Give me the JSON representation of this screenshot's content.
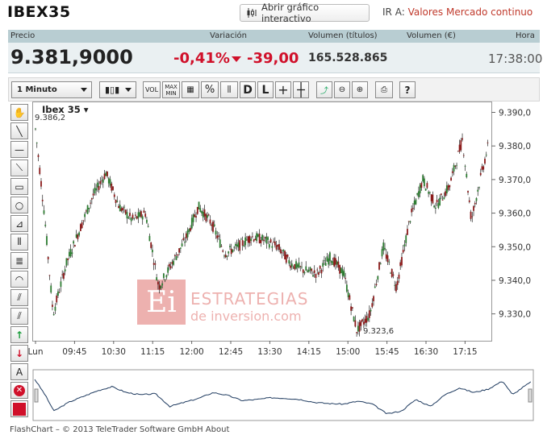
{
  "header": {
    "title": "IBEX35",
    "open_chart_label": "Abrir gráfico interactivo",
    "goto_label": "IR A:",
    "goto_value": "Valores Mercado continuo"
  },
  "quote": {
    "columns": [
      "Precio",
      "Variación",
      "Volumen (títulos)",
      "Volumen (€)",
      "Hora"
    ],
    "price": "9.381,9000",
    "change_pct": "-0,41%",
    "change_abs": "-39,00",
    "volume_shares": "165.528.865",
    "volume_eur": "",
    "time": "17:38:00",
    "colors": {
      "down": "#d0102a",
      "header_bg": "#b8cdd2",
      "row_bg": "#eaf0f2"
    }
  },
  "toolbar": {
    "interval": "1 Minuto",
    "buttons": [
      "VOL",
      "MAX\nMIN",
      "%",
      "D",
      "L"
    ],
    "icons": [
      "candlestick-type-icon",
      "grid-icon",
      "percent-icon",
      "compare-icon",
      "crosshair-icon",
      "cursor-icon",
      "trend-icon",
      "zoom-out-icon",
      "zoom-in-icon",
      "print-icon",
      "help-icon"
    ]
  },
  "left_tools": {
    "icons": [
      "hand-icon",
      "line-icon",
      "horizontal-line-icon",
      "channel-icon",
      "rectangle-icon",
      "circle-icon",
      "fan-icon",
      "fibonacci-icon",
      "fibonacci-grid-icon",
      "arc-icon",
      "parallel-icon",
      "parallel2-icon",
      "buy-arrow-icon",
      "sell-arrow-icon",
      "text-icon",
      "delete-icon",
      "color-icon"
    ],
    "text_label": "A"
  },
  "watermark": {
    "logo": "Ei",
    "line1": "ESTRATEGIAS",
    "line2": "de inversion.com"
  },
  "chart_data": {
    "type": "candlestick",
    "title": "Ibex 35",
    "high_label": "9.386,2",
    "low_label": "9.323,6",
    "x_ticks": [
      "Lun",
      "09:45",
      "10:30",
      "11:15",
      "12:00",
      "12:45",
      "13:30",
      "14:15",
      "15:00",
      "15:45",
      "16:30",
      "17:15"
    ],
    "y_ticks": [
      "9.390,0",
      "9.380,0",
      "9.370,0",
      "9.360,0",
      "9.350,0",
      "9.340,0",
      "9.330,0"
    ],
    "ylim": [
      9322,
      9393
    ],
    "x": [
      "09:00",
      "09:10",
      "09:20",
      "09:35",
      "09:50",
      "10:05",
      "10:20",
      "10:35",
      "10:50",
      "11:05",
      "11:20",
      "11:35",
      "11:50",
      "12:05",
      "12:20",
      "12:35",
      "12:50",
      "13:05",
      "13:20",
      "13:35",
      "13:50",
      "14:05",
      "14:20",
      "14:35",
      "14:50",
      "15:05",
      "15:20",
      "15:35",
      "15:50",
      "16:05",
      "16:20",
      "16:35",
      "16:50",
      "17:05",
      "17:15",
      "17:25",
      "17:35"
    ],
    "close": [
      9385,
      9360,
      9330,
      9345,
      9355,
      9365,
      9372,
      9362,
      9358,
      9360,
      9338,
      9345,
      9352,
      9362,
      9357,
      9348,
      9350,
      9353,
      9352,
      9350,
      9345,
      9343,
      9342,
      9347,
      9342,
      9325,
      9330,
      9350,
      9338,
      9358,
      9370,
      9362,
      9368,
      9382,
      9358,
      9370,
      9381
    ]
  },
  "footer": {
    "text": "FlashChart – © 2013 TeleTrader Software GmbH About"
  }
}
